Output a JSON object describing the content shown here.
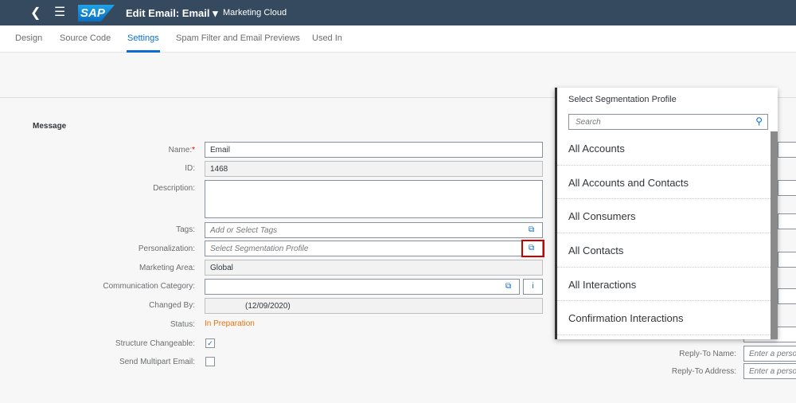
{
  "shell": {
    "logo": "SAP",
    "title": "Edit Email: Email",
    "subtitle": "Marketing Cloud"
  },
  "tabs": [
    {
      "label": "Design"
    },
    {
      "label": "Source Code"
    },
    {
      "label": "Settings",
      "active": true
    },
    {
      "label": "Spam Filter and Email Previews"
    },
    {
      "label": "Used In"
    }
  ],
  "section": "Message",
  "form": {
    "name_label": "Name:",
    "name_value": "Email",
    "id_label": "ID:",
    "id_value": "1468",
    "description_label": "Description:",
    "tags_label": "Tags:",
    "tags_placeholder": "Add or Select Tags",
    "personalization_label": "Personalization:",
    "personalization_placeholder": "Select Segmentation Profile",
    "marketing_area_label": "Marketing Area:",
    "marketing_area_value": "Global",
    "communication_category_label": "Communication Category:",
    "changed_by_label": "Changed By:",
    "changed_by_value": "(12/09/2020)",
    "status_label": "Status:",
    "status_value": "In Preparation",
    "structure_label": "Structure Changeable:",
    "structure_checked": true,
    "multipart_label": "Send Multipart Email:",
    "multipart_checked": false,
    "reply_to_name_label": "Reply-To Name:",
    "reply_to_name_placeholder": "Enter a person",
    "reply_to_address_label": "Reply-To Address:",
    "reply_to_address_placeholder": "Enter a person"
  },
  "popover": {
    "title": "Select Segmentation Profile",
    "search_placeholder": "Search",
    "items": [
      "All Accounts",
      "All Accounts and Contacts",
      "All Consumers",
      "All Contacts",
      "All Interactions",
      "Confirmation Interactions"
    ]
  },
  "colors": {
    "shell": "#354a5f",
    "accent": "#0a6ed1",
    "status": "#e9730c",
    "highlight": "#cc0000"
  }
}
